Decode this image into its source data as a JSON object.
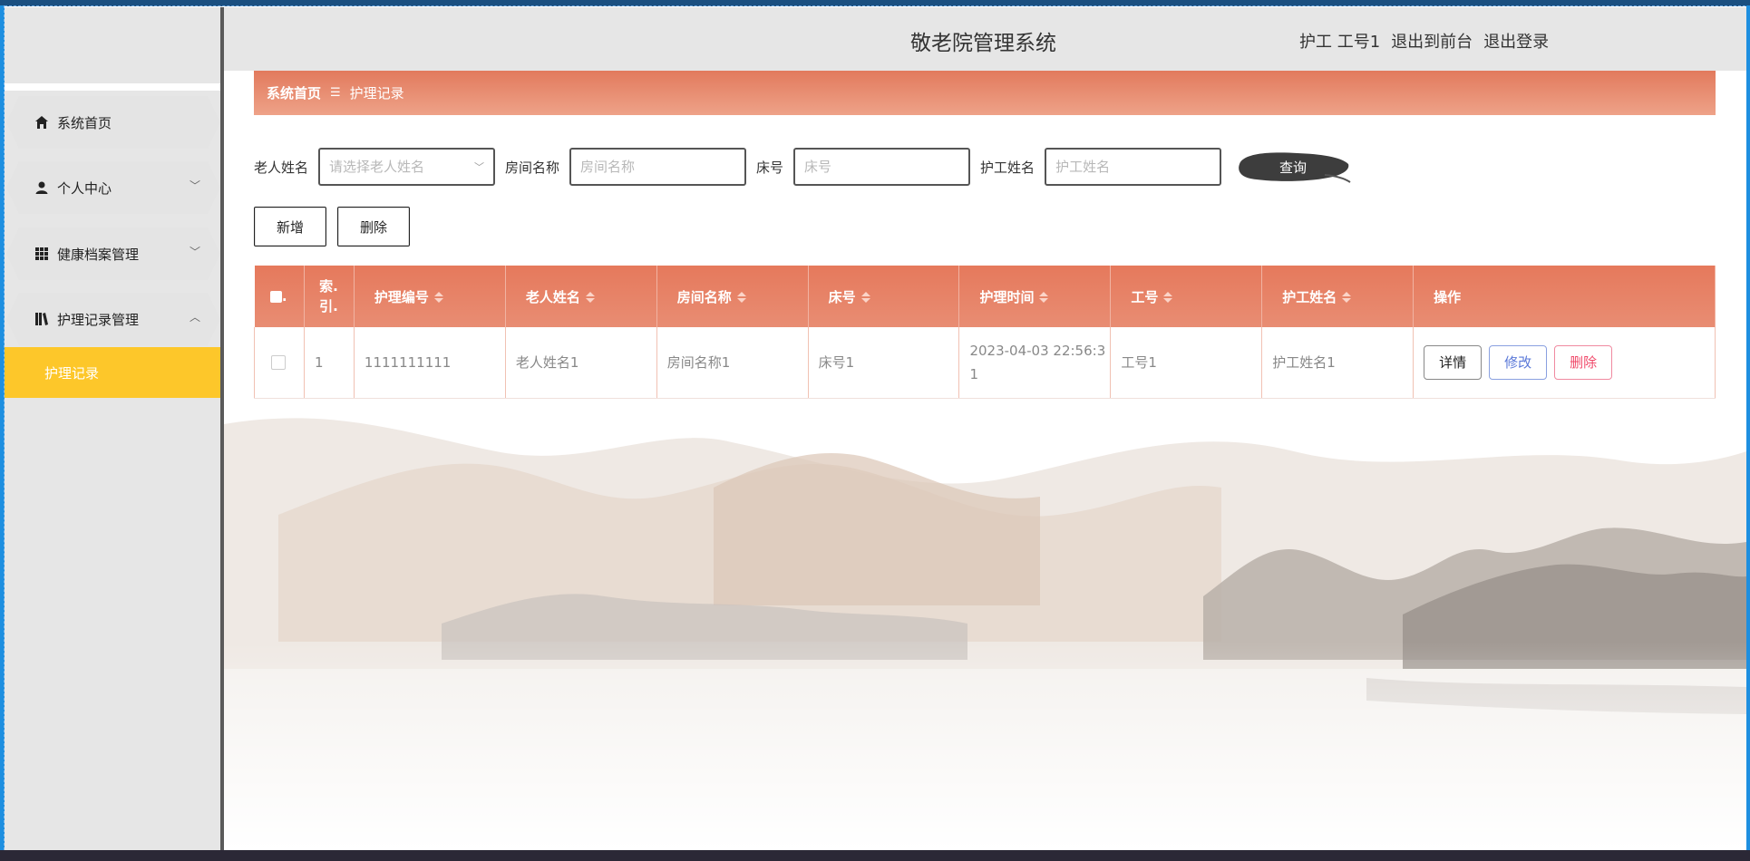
{
  "app": {
    "title": "敬老院管理系统",
    "user_role": "护工",
    "user_name": "工号1",
    "to_front_label": "退出到前台",
    "logout_label": "退出登录"
  },
  "sidebar": {
    "items": [
      {
        "label": "系统首页",
        "icon": "home-icon"
      },
      {
        "label": "个人中心",
        "icon": "user-icon"
      },
      {
        "label": "健康档案管理",
        "icon": "grid-icon"
      },
      {
        "label": "护理记录管理",
        "icon": "book-icon"
      }
    ],
    "sub_items": [
      {
        "label": "护理记录"
      }
    ]
  },
  "breadcrumb": {
    "home": "系统首页",
    "separator": "☰",
    "current": "护理记录"
  },
  "search": {
    "elder_label": "老人姓名",
    "elder_placeholder": "请选择老人姓名",
    "room_label": "房间名称",
    "room_placeholder": "房间名称",
    "bed_label": "床号",
    "bed_placeholder": "床号",
    "nurse_label": "护工姓名",
    "nurse_placeholder": "护工姓名",
    "query_label": "查询"
  },
  "actions": {
    "add_label": "新增",
    "delete_label": "删除"
  },
  "table": {
    "headers": [
      "索引",
      "护理编号",
      "老人姓名",
      "房间名称",
      "床号",
      "护理时间",
      "工号",
      "护工姓名",
      "操作"
    ],
    "index_header_line1": "索.",
    "index_header_line2": "引.",
    "rows": [
      {
        "index": "1",
        "care_no": "1111111111",
        "elder_name": "老人姓名1",
        "room_name": "房间名称1",
        "bed_no": "床号1",
        "care_time_line1": "2023-04-03 22:56:3",
        "care_time_line2": "1",
        "staff_no": "工号1",
        "nurse_name": "护工姓名1"
      }
    ],
    "row_actions": {
      "detail": "详情",
      "edit": "修改",
      "delete": "删除"
    }
  },
  "colors": {
    "accent": "#e6795c",
    "sidebar_active": "#fdc72a",
    "sidebar_bg": "#e6e6e6"
  }
}
